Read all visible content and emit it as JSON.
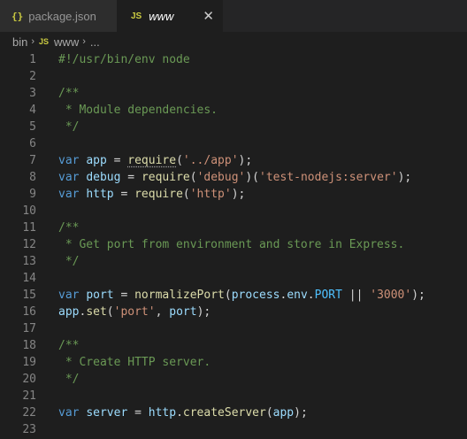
{
  "tabs": [
    {
      "label": "package.json",
      "icon": "json-icon"
    },
    {
      "label": "www",
      "icon": "js-icon",
      "active": true
    }
  ],
  "breadcrumb": {
    "folder": "bin",
    "file": "www",
    "ellipsis": "..."
  },
  "icons": {
    "json": "{}",
    "js": "JS",
    "close": "✕",
    "chevron": "›"
  },
  "lines": [
    [
      [
        "c",
        "#!/usr/bin/env node"
      ]
    ],
    [],
    [
      [
        "c",
        "/**"
      ]
    ],
    [
      [
        "c",
        " * Module dependencies."
      ]
    ],
    [
      [
        "c",
        " */"
      ]
    ],
    [],
    [
      [
        "k",
        "var"
      ],
      [
        "p",
        " "
      ],
      [
        "v",
        "app"
      ],
      [
        "p",
        " = "
      ],
      [
        "f",
        "require",
        "sq"
      ],
      [
        "p",
        "("
      ],
      [
        "s",
        "'../app'"
      ],
      [
        "p",
        ");"
      ]
    ],
    [
      [
        "k",
        "var"
      ],
      [
        "p",
        " "
      ],
      [
        "v",
        "debug"
      ],
      [
        "p",
        " = "
      ],
      [
        "f",
        "require"
      ],
      [
        "p",
        "("
      ],
      [
        "s",
        "'debug'"
      ],
      [
        "p",
        ")("
      ],
      [
        "s",
        "'test-nodejs:server'"
      ],
      [
        "p",
        ");"
      ]
    ],
    [
      [
        "k",
        "var"
      ],
      [
        "p",
        " "
      ],
      [
        "v",
        "http"
      ],
      [
        "p",
        " = "
      ],
      [
        "f",
        "require"
      ],
      [
        "p",
        "("
      ],
      [
        "s",
        "'http'"
      ],
      [
        "p",
        ");"
      ]
    ],
    [],
    [
      [
        "c",
        "/**"
      ]
    ],
    [
      [
        "c",
        " * Get port from environment and store in Express."
      ]
    ],
    [
      [
        "c",
        " */"
      ]
    ],
    [],
    [
      [
        "k",
        "var"
      ],
      [
        "p",
        " "
      ],
      [
        "v",
        "port"
      ],
      [
        "p",
        " = "
      ],
      [
        "f",
        "normalizePort"
      ],
      [
        "p",
        "("
      ],
      [
        "v",
        "process"
      ],
      [
        "p",
        "."
      ],
      [
        "v",
        "env"
      ],
      [
        "p",
        "."
      ],
      [
        "cst",
        "PORT"
      ],
      [
        "p",
        " || "
      ],
      [
        "s",
        "'3000'"
      ],
      [
        "p",
        ");"
      ]
    ],
    [
      [
        "v",
        "app"
      ],
      [
        "p",
        "."
      ],
      [
        "f",
        "set"
      ],
      [
        "p",
        "("
      ],
      [
        "s",
        "'port'"
      ],
      [
        "p",
        ", "
      ],
      [
        "v",
        "port"
      ],
      [
        "p",
        ");"
      ]
    ],
    [],
    [
      [
        "c",
        "/**"
      ]
    ],
    [
      [
        "c",
        " * Create HTTP server."
      ]
    ],
    [
      [
        "c",
        " */"
      ]
    ],
    [],
    [
      [
        "k",
        "var"
      ],
      [
        "p",
        " "
      ],
      [
        "v",
        "server"
      ],
      [
        "p",
        " = "
      ],
      [
        "v",
        "http"
      ],
      [
        "p",
        "."
      ],
      [
        "f",
        "createServer"
      ],
      [
        "p",
        "("
      ],
      [
        "v",
        "app"
      ],
      [
        "p",
        ");"
      ]
    ],
    []
  ]
}
